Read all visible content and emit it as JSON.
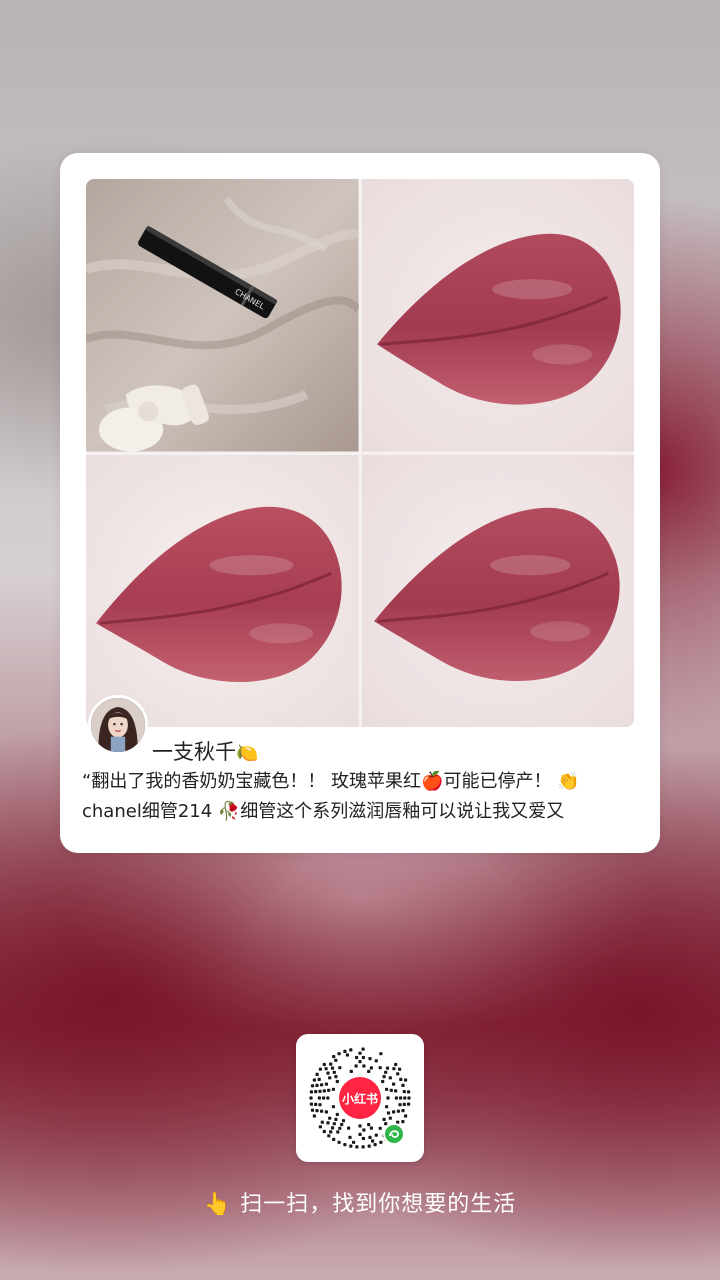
{
  "post": {
    "images": [
      {
        "name": "chanel-lipstick-photo",
        "brand_text": "CHANEL"
      },
      {
        "name": "lip-swatch-1"
      },
      {
        "name": "lip-swatch-2"
      },
      {
        "name": "lip-swatch-3"
      }
    ],
    "author": {
      "name": "一支秋千",
      "name_emoji": "🍋"
    },
    "description": {
      "line1": "“翻出了我的香奶奶宝藏色！！ 玫瑰苹果红🍎可能已停产！ 👏",
      "line2": "chanel细管214 🥀细管这个系列滋润唇釉可以说让我又爱又"
    }
  },
  "qr": {
    "logo_text": "小红书",
    "badge_icon": "mini-program-icon"
  },
  "footer": {
    "pointer_emoji": "👆",
    "slogan": "扫一扫，找到你想要的生活"
  },
  "colors": {
    "brand_red": "#ff2442",
    "lip_color": "#b8445a"
  }
}
